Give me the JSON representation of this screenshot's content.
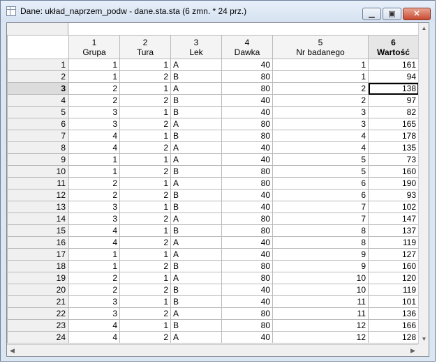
{
  "window": {
    "title": "Dane: układ_naprzem_podw - dane.sta.sta (6 zmn. * 24 prz.)",
    "minimize": "▁",
    "maximize": "▣",
    "close": "✕"
  },
  "columns": [
    {
      "num": "1",
      "name": "Grupa",
      "align": "num"
    },
    {
      "num": "2",
      "name": "Tura",
      "align": "num"
    },
    {
      "num": "3",
      "name": "Lek",
      "align": "txt"
    },
    {
      "num": "4",
      "name": "Dawka",
      "align": "num"
    },
    {
      "num": "5",
      "name": "Nr badanego",
      "align": "num"
    },
    {
      "num": "6",
      "name": "Wartość",
      "align": "num"
    }
  ],
  "active_column": 5,
  "selected_row": 2,
  "rows": [
    [
      "1",
      "1",
      "1",
      "A",
      "40",
      "1",
      "161"
    ],
    [
      "2",
      "1",
      "2",
      "B",
      "80",
      "1",
      "94"
    ],
    [
      "3",
      "2",
      "1",
      "A",
      "80",
      "2",
      "138"
    ],
    [
      "4",
      "2",
      "2",
      "B",
      "40",
      "2",
      "97"
    ],
    [
      "5",
      "3",
      "1",
      "B",
      "40",
      "3",
      "82"
    ],
    [
      "6",
      "3",
      "2",
      "A",
      "80",
      "3",
      "165"
    ],
    [
      "7",
      "4",
      "1",
      "B",
      "80",
      "4",
      "178"
    ],
    [
      "8",
      "4",
      "2",
      "A",
      "40",
      "4",
      "135"
    ],
    [
      "9",
      "1",
      "1",
      "A",
      "40",
      "5",
      "73"
    ],
    [
      "10",
      "1",
      "2",
      "B",
      "80",
      "5",
      "160"
    ],
    [
      "11",
      "2",
      "1",
      "A",
      "80",
      "6",
      "190"
    ],
    [
      "12",
      "2",
      "2",
      "B",
      "40",
      "6",
      "93"
    ],
    [
      "13",
      "3",
      "1",
      "B",
      "40",
      "7",
      "102"
    ],
    [
      "14",
      "3",
      "2",
      "A",
      "80",
      "7",
      "147"
    ],
    [
      "15",
      "4",
      "1",
      "B",
      "80",
      "8",
      "137"
    ],
    [
      "16",
      "4",
      "2",
      "A",
      "40",
      "8",
      "119"
    ],
    [
      "17",
      "1",
      "1",
      "A",
      "40",
      "9",
      "127"
    ],
    [
      "18",
      "1",
      "2",
      "B",
      "80",
      "9",
      "160"
    ],
    [
      "19",
      "2",
      "1",
      "A",
      "80",
      "10",
      "120"
    ],
    [
      "20",
      "2",
      "2",
      "B",
      "40",
      "10",
      "119"
    ],
    [
      "21",
      "3",
      "1",
      "B",
      "40",
      "11",
      "101"
    ],
    [
      "22",
      "3",
      "2",
      "A",
      "80",
      "11",
      "136"
    ],
    [
      "23",
      "4",
      "1",
      "B",
      "80",
      "12",
      "166"
    ],
    [
      "24",
      "4",
      "2",
      "A",
      "40",
      "12",
      "128"
    ]
  ],
  "scroll": {
    "up": "▲",
    "down": "▼",
    "left": "◀",
    "right": "▶"
  }
}
